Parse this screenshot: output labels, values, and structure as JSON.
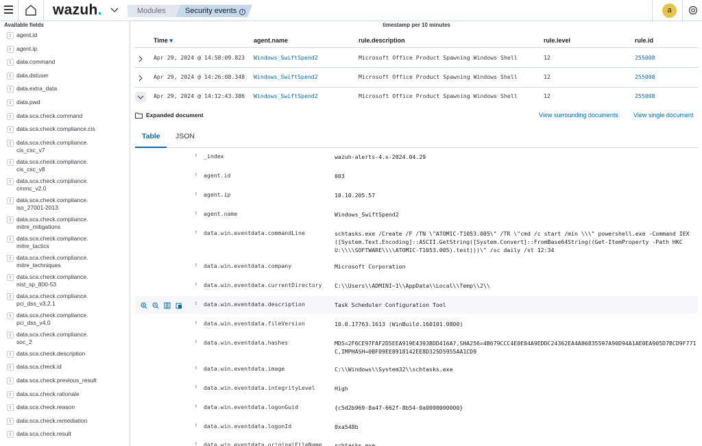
{
  "header": {
    "logo_text": "wazuh",
    "logo_dot": ".",
    "breadcrumb": [
      "Modules",
      "Security events"
    ],
    "info_symbol": "i",
    "avatar_letter": "a",
    "colors": {
      "accent": "#006bb4",
      "logo_dot": "#00a9e5",
      "avatar": "#e7c34a"
    }
  },
  "sidebar": {
    "title": "Available fields",
    "type_badge": "t",
    "fields": [
      "agent.id",
      "agent.ip",
      "data.command",
      "data.dstuser",
      "data.extra_data",
      "data.pwd",
      "data.sca.check.command",
      "data.sca.check.compliance.cis",
      "data.sca.check.compliance.\ncis_csc_v7",
      "data.sca.check.compliance.\ncis_csc_v8",
      "data.sca.check.compliance.\ncmmc_v2.0",
      "data.sca.check.compliance.\niso_27001-2013",
      "data.sca.check.compliance.\nmitre_mitigations",
      "data.sca.check.compliance.\nmitre_tactics",
      "data.sca.check.compliance.\nmitre_techniques",
      "data.sca.check.compliance.\nnist_sp_800-53",
      "data.sca.check.compliance.\npci_dss_v3.2.1",
      "data.sca.check.compliance.\npci_dss_v4.0",
      "data.sca.check.compliance.\nsoc_2",
      "data.sca.check.description",
      "data.sca.check.id",
      "data.sca.check.previous_result",
      "data.sca.check.rationale",
      "data.sca.check.reason",
      "data.sca.check.remediation",
      "data.sca.check.result"
    ]
  },
  "main": {
    "subtitle": "timestamp per 10 minutes",
    "columns": [
      "Time",
      "agent.name",
      "rule.description",
      "rule.level",
      "rule.id"
    ],
    "sort_indicator": "▾",
    "rows": [
      {
        "time": "Apr 29, 2024 @ 14:58:09.823",
        "agent": "Windows_SwiftSpend2",
        "description": "Microsoft Office Product Spawning Windows Shell",
        "level": "12",
        "id": "255008"
      },
      {
        "time": "Apr 29, 2024 @ 14:26:08.348",
        "agent": "Windows_SwiftSpend2",
        "description": "Microsoft Office Product Spawning Windows Shell",
        "level": "12",
        "id": "255008"
      },
      {
        "time": "Apr 29, 2024 @ 14:12:43.386",
        "agent": "Windows_SwiftSpend2",
        "description": "Microsoft Office Product Spawning Windows Shell",
        "level": "12",
        "id": "255008"
      }
    ],
    "expanded": {
      "title": "Expanded document",
      "view_surrounding": "View surrounding documents",
      "view_single": "View single document",
      "tabs": [
        "Table",
        "JSON"
      ],
      "type_badge": "t",
      "fields": [
        {
          "key": "_index",
          "value": "wazuh-alerts-4.x-2024.04.29"
        },
        {
          "key": "agent.id",
          "value": "003",
          "link": true
        },
        {
          "key": "agent.ip",
          "value": "10.10.205.57"
        },
        {
          "key": "agent.name",
          "value": "Windows_SwiftSpend2",
          "link": true
        },
        {
          "key": "data.win.eventdata.commandLine",
          "value": "schtasks.exe  /Create /F /TN \\\"ATOMIC-T1053.005\\\" /TR \\\"cmd /c start /min \\\\\\\" powershell.exe -Command IEX([System.Text.Encoding]::ASCII.GetString([System.Convert]::FromBase64String((Get-ItemProperty -Path HKCU:\\\\\\\\SOFTWARE\\\\\\\\ATOMIC-T1053.005).test)))\\\" /sc daily /st 12:34"
        },
        {
          "key": "data.win.eventdata.company",
          "value": "Microsoft Corporation"
        },
        {
          "key": "data.win.eventdata.currentDirectory",
          "value": "C:\\\\Users\\\\ADMINI~1\\\\AppData\\\\Local\\\\Temp\\\\2\\\\"
        },
        {
          "key": "data.win.eventdata.description",
          "value": "Task Scheduler Configuration Tool"
        },
        {
          "key": "data.win.eventdata.fileVersion",
          "value": "10.0.17763.1613 (WinBuild.160101.0800)"
        },
        {
          "key": "data.win.eventdata.hashes",
          "value": "MD5=2F6CE97FAF2D5EEA919E4393BDD416A7,SHA256=4B679CCC4E0E84A9EDDC24362EA4A86835597A90D94A1AE0EA905D7BCD9F771C,IMPHASH=0BF09EE8918142EE8D325D5955AA1CD9"
        },
        {
          "key": "data.win.eventdata.image",
          "value": "C:\\\\Windows\\\\System32\\\\schtasks.exe"
        },
        {
          "key": "data.win.eventdata.integrityLevel",
          "value": "High"
        },
        {
          "key": "data.win.eventdata.logonGuid",
          "value": "{c5d2b969-8a47-662f-8b54-0a0000000000}"
        },
        {
          "key": "data.win.eventdata.logonId",
          "value": "0xa548b"
        },
        {
          "key": "data.win.eventdata.originalFileName",
          "value": "schtasks.exe"
        }
      ]
    }
  }
}
